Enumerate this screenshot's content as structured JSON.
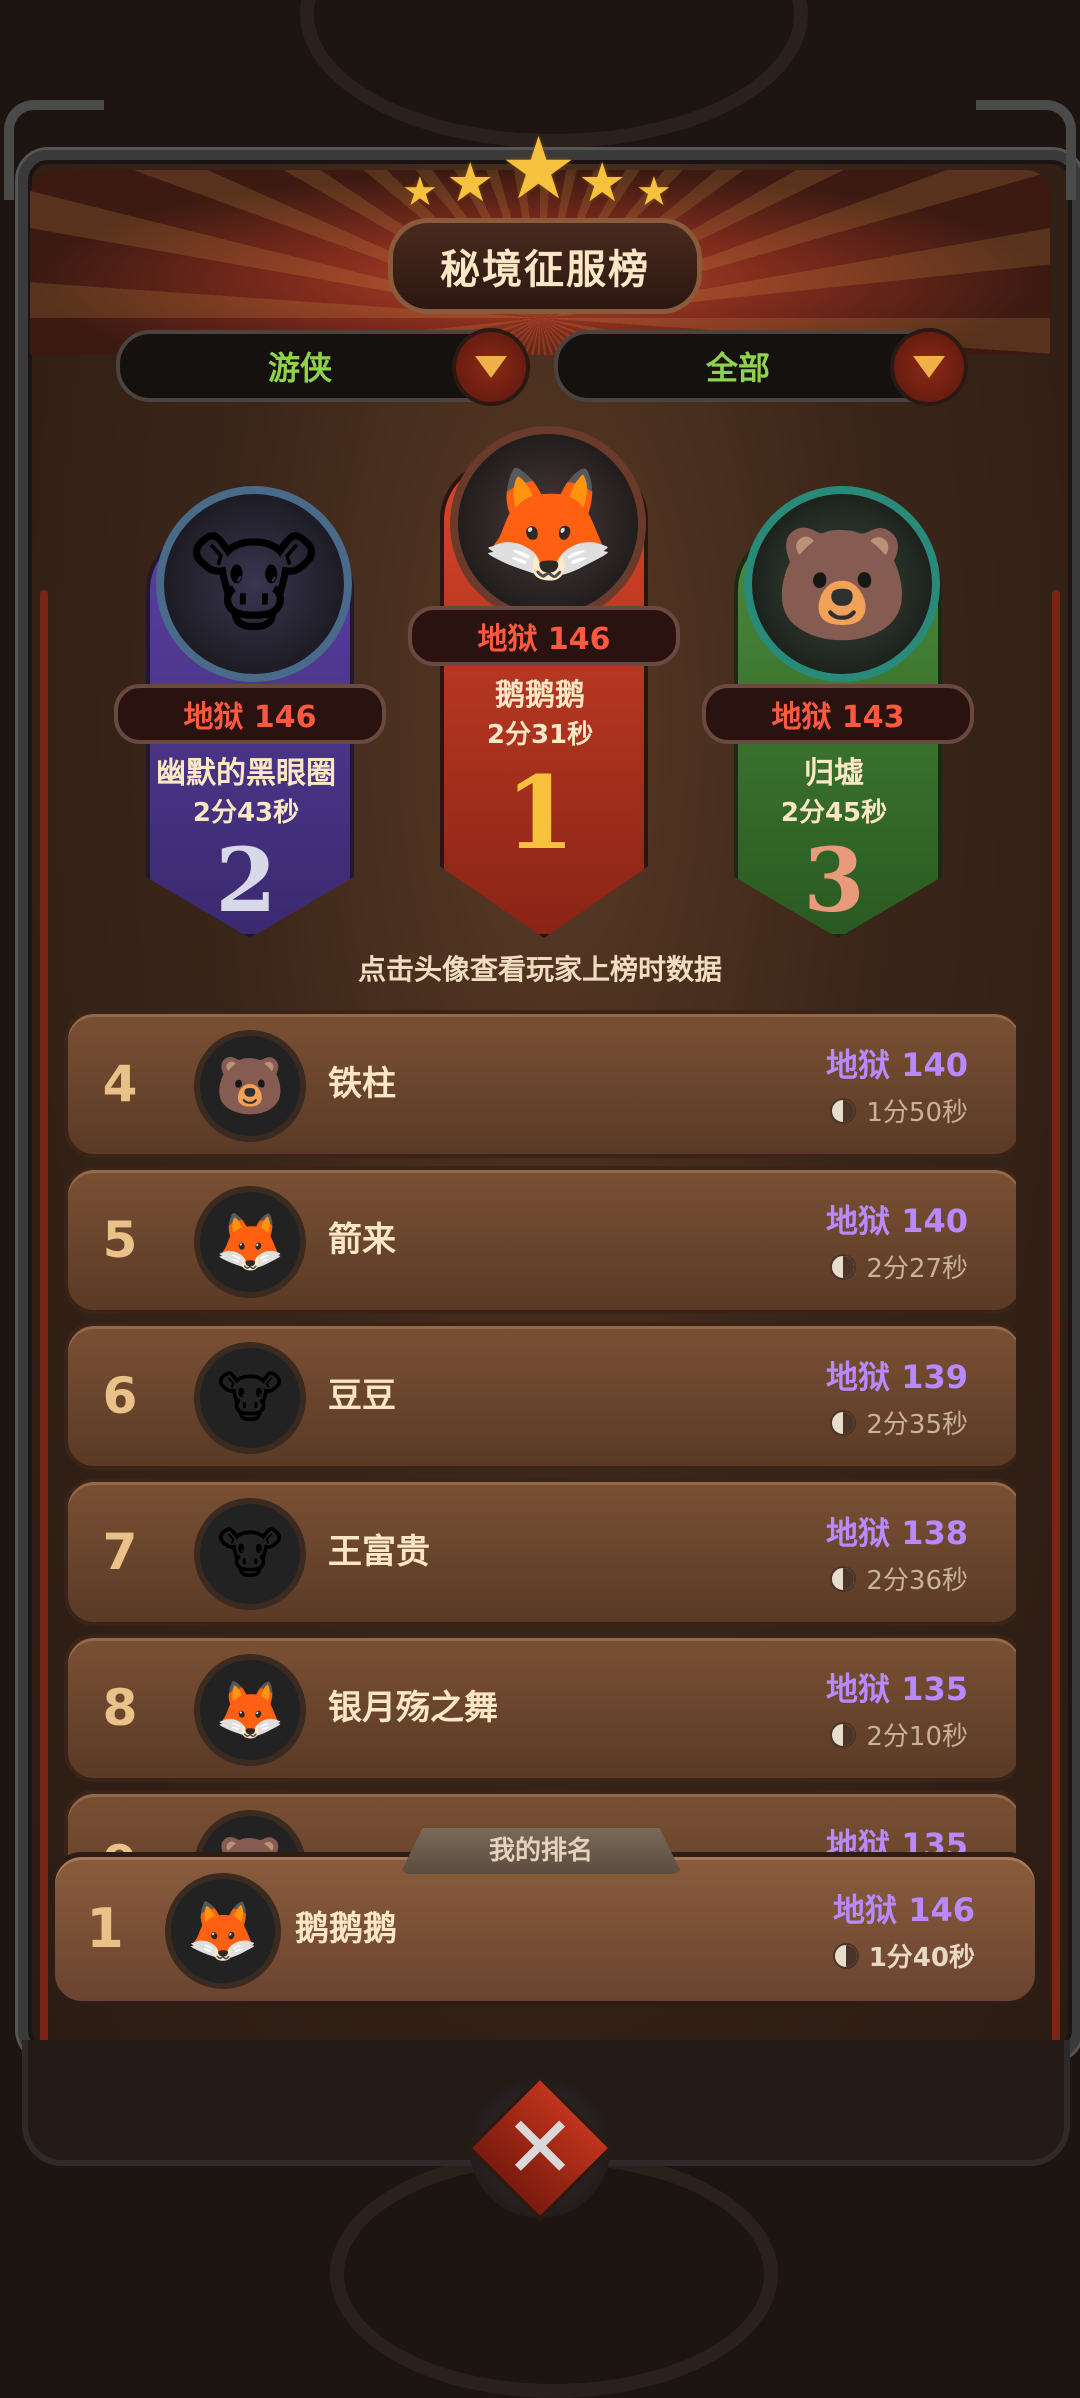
{
  "title": "秘境征服榜",
  "filters": [
    {
      "label": "游侠"
    },
    {
      "label": "全部"
    }
  ],
  "podium": [
    {
      "rank": "2",
      "score": "地狱 146",
      "name": "幽默的黑眼圈",
      "time": "2分43秒",
      "avatar": "cow",
      "face": "🐮"
    },
    {
      "rank": "1",
      "score": "地狱 146",
      "name": "鹅鹅鹅",
      "time": "2分31秒",
      "avatar": "fox",
      "face": "🦊"
    },
    {
      "rank": "3",
      "score": "地狱 143",
      "name": "归墟",
      "time": "2分45秒",
      "avatar": "bear",
      "face": "🐻"
    }
  ],
  "hint": "点击头像查看玩家上榜时数据",
  "list": [
    {
      "rank": "4",
      "name": "铁柱",
      "score": "地狱 140",
      "time": "1分50秒",
      "avatar": "bear",
      "face": "🐻"
    },
    {
      "rank": "5",
      "name": "箭来",
      "score": "地狱 140",
      "time": "2分27秒",
      "avatar": "fox",
      "face": "🦊"
    },
    {
      "rank": "6",
      "name": "豆豆",
      "score": "地狱 139",
      "time": "2分35秒",
      "avatar": "cow",
      "face": "🐮"
    },
    {
      "rank": "7",
      "name": "王富贵",
      "score": "地狱 138",
      "time": "2分36秒",
      "avatar": "cow",
      "face": "🐮"
    },
    {
      "rank": "8",
      "name": "银月殇之舞",
      "score": "地狱 135",
      "time": "2分10秒",
      "avatar": "fox",
      "face": "🦊"
    },
    {
      "rank": "9",
      "name": "",
      "score": "地狱 135",
      "time": "",
      "avatar": "bear",
      "face": "🐻"
    }
  ],
  "my_rank": {
    "tab_label": "我的排名",
    "rank": "1",
    "name": "鹅鹅鹅",
    "score": "地狱 146",
    "time": "1分40秒",
    "avatar": "fox",
    "face": "🦊"
  },
  "icons": {
    "dropdown": "chevron-down-icon",
    "clock": "clock-icon",
    "close": "close-icon",
    "star": "star-icon"
  },
  "colors": {
    "score_hell": "#ff5a40",
    "score_list": "#b98aff",
    "filter_text": "#8fd34b",
    "gold": "#f6c23e"
  }
}
